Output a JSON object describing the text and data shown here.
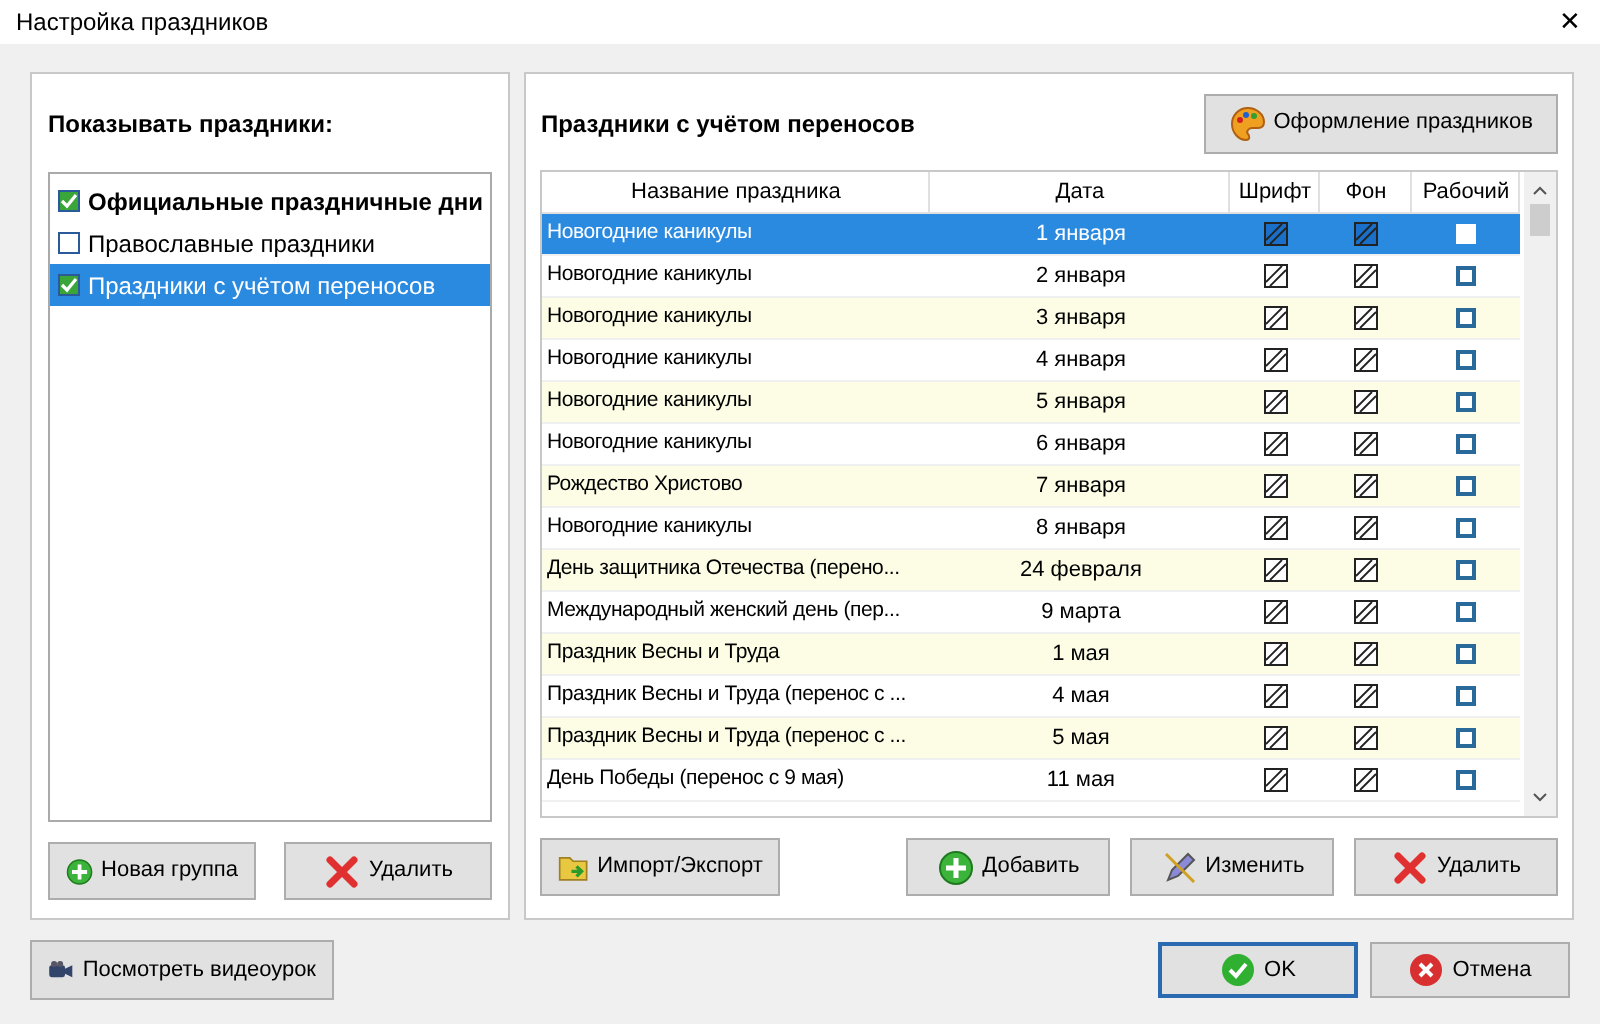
{
  "window": {
    "title": "Настройка праздников",
    "close": "✕"
  },
  "left": {
    "heading": "Показывать праздники:",
    "items": [
      {
        "label": "Официальные праздничные дни",
        "checked": true,
        "bold": true,
        "selected": false
      },
      {
        "label": "Православные праздники",
        "checked": false,
        "bold": false,
        "selected": false
      },
      {
        "label": "Праздники с учётом переносов",
        "checked": true,
        "bold": false,
        "selected": true
      }
    ],
    "buttons": [
      {
        "label": "Новая группа",
        "kind": "add"
      },
      {
        "label": "Удалить",
        "kind": "delete"
      }
    ]
  },
  "right": {
    "heading": "Праздники с учётом переносов",
    "style_button": "Оформление праздников",
    "table": {
      "columns": [
        "Название праздника",
        "Дата",
        "Шрифт",
        "Фон",
        "Рабочий"
      ],
      "rows": [
        {
          "name": "Новогодние каникулы",
          "date": "1 января",
          "working": false,
          "selected": true
        },
        {
          "name": "Новогодние каникулы",
          "date": "2 января",
          "working": false,
          "selected": false
        },
        {
          "name": "Новогодние каникулы",
          "date": "3 января",
          "working": false,
          "selected": false
        },
        {
          "name": "Новогодние каникулы",
          "date": "4 января",
          "working": false,
          "selected": false
        },
        {
          "name": "Новогодние каникулы",
          "date": "5 января",
          "working": false,
          "selected": false
        },
        {
          "name": "Новогодние каникулы",
          "date": "6 января",
          "working": false,
          "selected": false
        },
        {
          "name": "Рождество Христово",
          "date": "7 января",
          "working": false,
          "selected": false
        },
        {
          "name": "Новогодние каникулы",
          "date": "8 января",
          "working": false,
          "selected": false
        },
        {
          "name": "День защитника Отечества (перено...",
          "date": "24 февраля",
          "working": false,
          "selected": false
        },
        {
          "name": "Международный женский день (пер...",
          "date": "9 марта",
          "working": false,
          "selected": false
        },
        {
          "name": "Праздник Весны и Труда",
          "date": "1 мая",
          "working": false,
          "selected": false
        },
        {
          "name": "Праздник Весны и Труда (перенос с ...",
          "date": "4 мая",
          "working": false,
          "selected": false
        },
        {
          "name": "Праздник Весны и Труда (перенос с ...",
          "date": "5 мая",
          "working": false,
          "selected": false
        },
        {
          "name": "День Победы (перенос с 9 мая)",
          "date": "11 мая",
          "working": false,
          "selected": false
        }
      ]
    },
    "buttons": [
      {
        "label": "Импорт/Экспорт",
        "kind": "import"
      },
      {
        "label": "Добавить",
        "kind": "add"
      },
      {
        "label": "Изменить",
        "kind": "edit"
      },
      {
        "label": "Удалить",
        "kind": "delete"
      }
    ]
  },
  "footer": {
    "video_button": "Посмотреть видеоурок",
    "ok_button": "OK",
    "cancel_button": "Отмена"
  }
}
